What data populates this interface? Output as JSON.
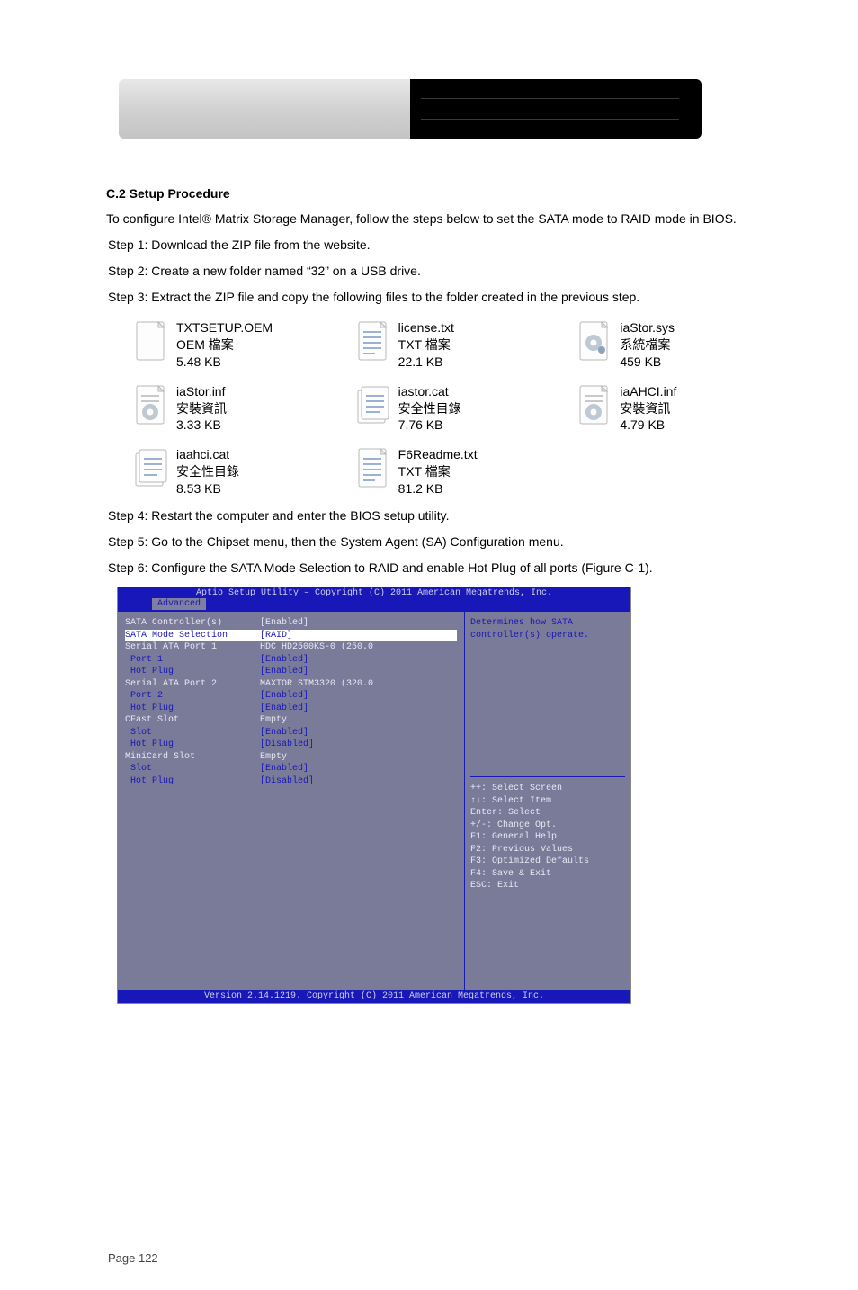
{
  "header": {
    "tab_left": "",
    "tab_right": ""
  },
  "section_title": "C.2 Setup Procedure",
  "intro": "To configure Intel® Matrix Storage Manager, follow the steps below to set the SATA mode to RAID mode in BIOS.",
  "steps": {
    "s1": "Step 1:   Download the ZIP file from the website.",
    "s2": "Step 2:   Create a new folder named “32” on a USB drive.",
    "s3": "Step 3:   Extract the ZIP file and copy the following files to the folder created in the previous step.",
    "s4": "Step 4:   Restart the computer and enter the BIOS setup utility.",
    "s5": "Step 5:   Go to the Chipset menu, then the System Agent (SA) Configuration menu.",
    "s6": "Step 6:   Configure the SATA Mode Selection to RAID and enable Hot Plug of all ports (Figure C-1)."
  },
  "files": [
    {
      "name": "TXTSETUP.OEM",
      "type": "OEM 檔案",
      "size": "5.48 KB",
      "icon": "blank"
    },
    {
      "name": "license.txt",
      "type": "TXT 檔案",
      "size": "22.1 KB",
      "icon": "txt"
    },
    {
      "name": "iaStor.sys",
      "type": "系統檔案",
      "size": "459 KB",
      "icon": "sys"
    },
    {
      "name": "iaStor.inf",
      "type": "安裝資訊",
      "size": "3.33 KB",
      "icon": "inf"
    },
    {
      "name": "iastor.cat",
      "type": "安全性目錄",
      "size": "7.76 KB",
      "icon": "cat"
    },
    {
      "name": "iaAHCI.inf",
      "type": "安裝資訊",
      "size": "4.79 KB",
      "icon": "inf"
    },
    {
      "name": "iaahci.cat",
      "type": "安全性目錄",
      "size": "8.53 KB",
      "icon": "cat"
    },
    {
      "name": "F6Readme.txt",
      "type": "TXT 檔案",
      "size": "81.2 KB",
      "icon": "txt"
    }
  ],
  "bios": {
    "title": "Aptio Setup Utility – Copyright (C) 2011 American Megatrends, Inc.",
    "tab": "Advanced",
    "help1": "Determines how SATA",
    "help2": "controller(s) operate.",
    "rows": [
      {
        "label": "SATA Controller(s)",
        "val": "[Enabled]",
        "cls": "wht"
      },
      {
        "label": "SATA Mode Selection",
        "val": "[RAID]",
        "cls": "sel"
      },
      {
        "label": "",
        "val": "",
        "cls": ""
      },
      {
        "label": "Serial ATA Port 1",
        "val": "HDC HD2500KS-0 (250.0",
        "cls": "wht-label"
      },
      {
        "label": " Port 1",
        "val": "[Enabled]",
        "cls": ""
      },
      {
        "label": " Hot Plug",
        "val": "[Enabled]",
        "cls": ""
      },
      {
        "label": "Serial ATA Port 2",
        "val": "MAXTOR STM3320 (320.0",
        "cls": "wht-label"
      },
      {
        "label": " Port 2",
        "val": "[Enabled]",
        "cls": ""
      },
      {
        "label": " Hot Plug",
        "val": "[Enabled]",
        "cls": ""
      },
      {
        "label": "CFast Slot",
        "val": "Empty",
        "cls": "wht-label"
      },
      {
        "label": " Slot",
        "val": "[Enabled]",
        "cls": ""
      },
      {
        "label": " Hot Plug",
        "val": "[Disabled]",
        "cls": ""
      },
      {
        "label": "MiniCard Slot",
        "val": "Empty",
        "cls": "wht-label"
      },
      {
        "label": " Slot",
        "val": "[Enabled]",
        "cls": ""
      },
      {
        "label": " Hot Plug",
        "val": "[Disabled]",
        "cls": ""
      }
    ],
    "keys": [
      "++: Select Screen",
      "↑↓: Select Item",
      "Enter: Select",
      "+/-: Change Opt.",
      "F1: General Help",
      "F2: Previous Values",
      "F3: Optimized Defaults",
      "F4: Save & Exit",
      "ESC: Exit"
    ],
    "footer": "Version 2.14.1219. Copyright (C) 2011 American Megatrends, Inc."
  },
  "page_footer": {
    "left": "Page 122",
    "right": ""
  }
}
